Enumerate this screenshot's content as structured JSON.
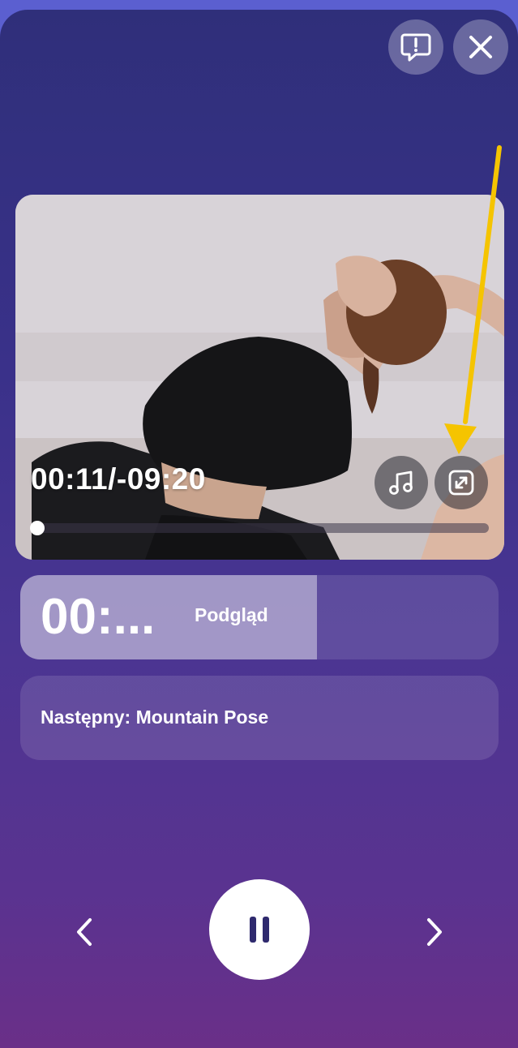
{
  "header": {
    "report_icon": "exclamation-speech-bubble-icon",
    "close_icon": "close-x-icon"
  },
  "video": {
    "elapsed": "00:11",
    "separator": "/",
    "remaining": "-09:20",
    "music_icon": "music-note-icon",
    "expand_icon": "expand-diagonal-icon",
    "progress_fraction": 0.02
  },
  "timer": {
    "value": "00:...",
    "label": "Podgląd",
    "fill_fraction": 0.62
  },
  "next_exercise": {
    "text": "Następny: Mountain Pose"
  },
  "controls": {
    "prev_icon": "chevron-left-icon",
    "pause_icon": "pause-icon",
    "next_icon": "chevron-right-icon"
  },
  "colors": {
    "annotation_arrow": "#f5c400",
    "pause_icon": "#2f2a6e"
  }
}
